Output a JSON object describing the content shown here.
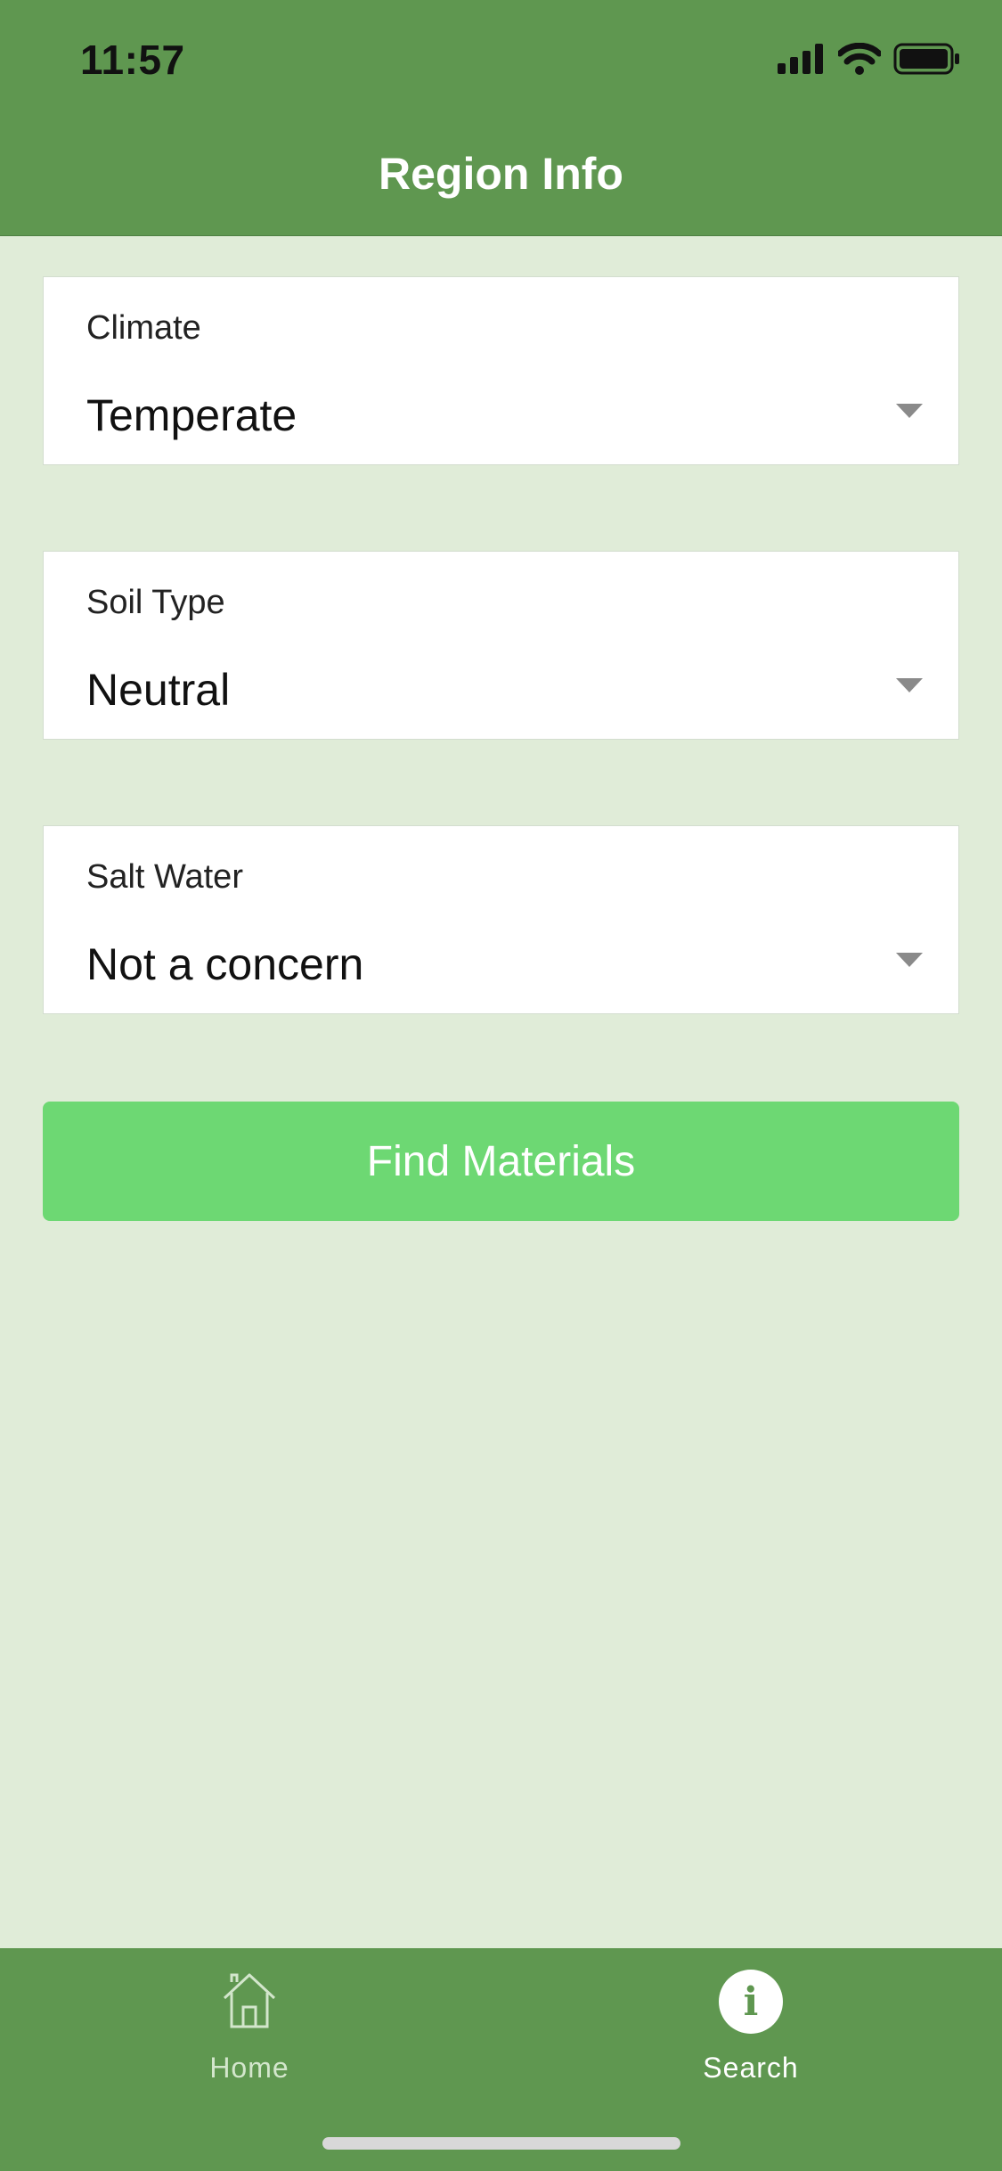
{
  "status_bar": {
    "time": "11:57",
    "icons": [
      "cellular-signal-icon",
      "wifi-icon",
      "battery-icon"
    ]
  },
  "header": {
    "title": "Region Info"
  },
  "form": {
    "fields": [
      {
        "label": "Climate",
        "value": "Temperate"
      },
      {
        "label": "Soil Type",
        "value": "Neutral"
      },
      {
        "label": "Salt Water",
        "value": "Not a concern"
      }
    ],
    "submit_label": "Find Materials"
  },
  "tab_bar": {
    "tabs": [
      {
        "label": "Home",
        "icon": "home-icon",
        "active": false
      },
      {
        "label": "Search",
        "icon": "info-icon",
        "active": true
      }
    ]
  },
  "colors": {
    "header_bg": "#5f9750",
    "page_bg": "#e0ecd8",
    "button_bg": "#6dd873",
    "card_bg": "#ffffff"
  }
}
